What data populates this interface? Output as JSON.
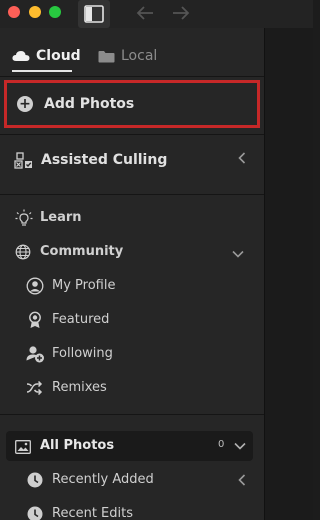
{
  "tabs": {
    "cloud": "Cloud",
    "local": "Local"
  },
  "add_photos": "Add Photos",
  "assisted_culling": "Assisted Culling",
  "nav": {
    "learn": "Learn",
    "community": "Community",
    "community_items": [
      "My Profile",
      "Featured",
      "Following",
      "Remixes"
    ]
  },
  "library": {
    "all_photos": "All Photos",
    "all_photos_count": "0",
    "items": [
      "Recently Added",
      "Recent Edits"
    ]
  },
  "colors": {
    "highlight_border": "#c62828",
    "accent_text": "#f0f0f0"
  },
  "icons": [
    "sidebar-toggle-icon",
    "back-arrow-icon",
    "forward-arrow-icon",
    "cloud-icon",
    "folder-icon",
    "plus-circle-icon",
    "culling-icon",
    "lightbulb-icon",
    "globe-icon",
    "profile-icon",
    "badge-icon",
    "add-person-icon",
    "remix-icon",
    "photos-icon",
    "clock-icon"
  ]
}
